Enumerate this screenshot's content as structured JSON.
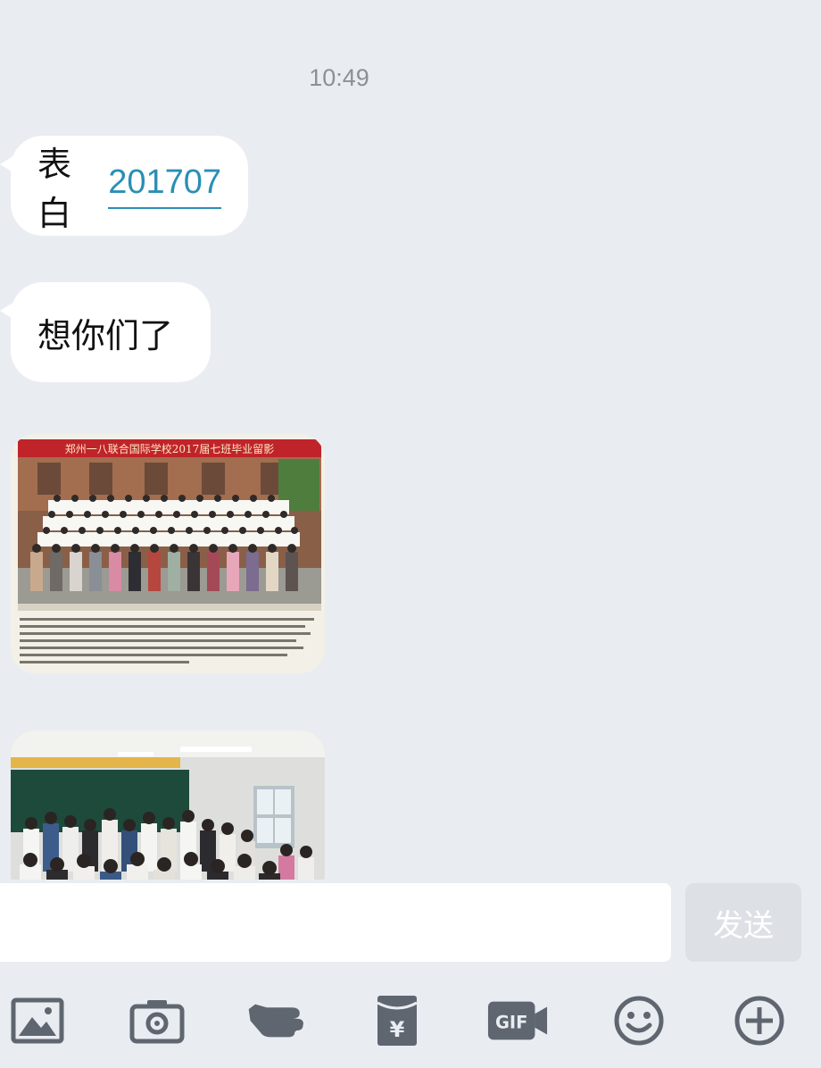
{
  "chat": {
    "timestamp": "10:49",
    "messages": [
      {
        "text": "表白",
        "link": "201707"
      },
      {
        "text": "想你们了"
      }
    ],
    "photos": [
      {
        "caption": "郑州一八联合国际学校2017届七班毕业留影"
      },
      {
        "caption": ""
      }
    ]
  },
  "composer": {
    "input_value": "",
    "send_label": "发送"
  },
  "toolbar": {
    "items": [
      {
        "icon": "image-icon"
      },
      {
        "icon": "camera-icon"
      },
      {
        "icon": "poke-hand-icon"
      },
      {
        "icon": "red-packet-icon"
      },
      {
        "icon": "gif-icon"
      },
      {
        "icon": "emoji-icon"
      },
      {
        "icon": "plus-icon"
      }
    ]
  },
  "colors": {
    "background": "#e9edf2",
    "link": "#2a8fb4",
    "icon": "#5f6670",
    "send_disabled": "#dde1e6"
  }
}
